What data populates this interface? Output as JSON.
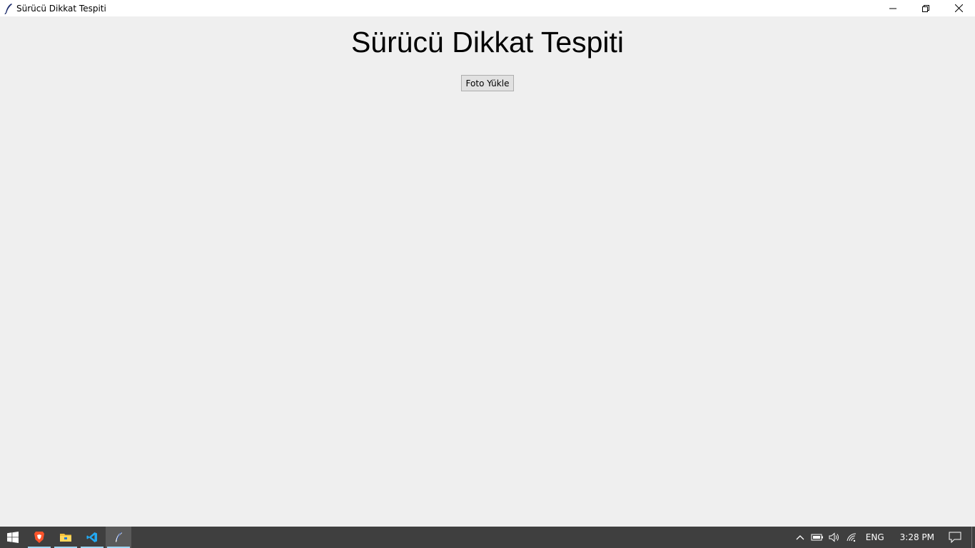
{
  "window": {
    "title": "Sürücü Dikkat Tespiti"
  },
  "main": {
    "heading": "Sürücü Dikkat Tespiti",
    "upload_button_label": "Foto Yükle"
  },
  "taskbar": {
    "apps": [
      "windows-start",
      "brave-browser",
      "file-explorer",
      "vscode",
      "python-tk"
    ],
    "language": "ENG",
    "time": "3:28 PM"
  },
  "colors": {
    "background": "#efefef",
    "taskbar": "#3f3f3f",
    "active_underline": "#9fd8f5"
  }
}
